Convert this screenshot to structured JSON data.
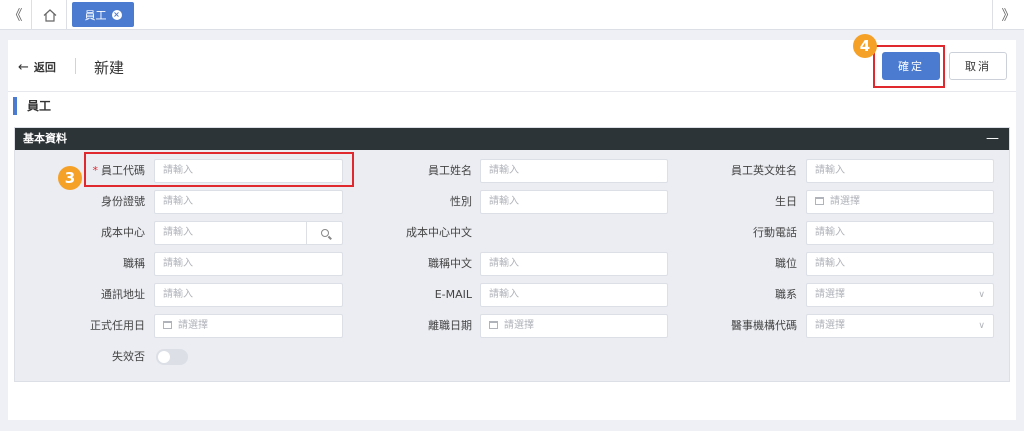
{
  "topbar": {
    "nav_left": "《",
    "nav_right": "》",
    "home_icon": "home-icon",
    "tab_label": "員工",
    "tab_close": "×"
  },
  "header": {
    "back_label": "返回",
    "title": "新建",
    "confirm_label": "確定",
    "cancel_label": "取消"
  },
  "callouts": {
    "step3": "3",
    "step4": "4"
  },
  "section_title": "員工",
  "panel": {
    "title": "基本資料",
    "collapse": "—"
  },
  "fields": {
    "emp_code": {
      "label": "員工代碼",
      "required": "*",
      "placeholder": "請輸入"
    },
    "emp_name": {
      "label": "員工姓名",
      "placeholder": "請輸入"
    },
    "emp_en_name": {
      "label": "員工英文姓名",
      "placeholder": "請輸入"
    },
    "id_no": {
      "label": "身份證號",
      "placeholder": "請輸入"
    },
    "gender": {
      "label": "性別",
      "placeholder": "請輸入"
    },
    "birthday": {
      "label": "生日",
      "placeholder": "請選擇"
    },
    "cost_center": {
      "label": "成本中心",
      "placeholder": "請輸入"
    },
    "cost_center_cn": {
      "label": "成本中心中文"
    },
    "mobile": {
      "label": "行動電話",
      "placeholder": "請輸入"
    },
    "job_title": {
      "label": "職稱",
      "placeholder": "請輸入"
    },
    "job_title_cn": {
      "label": "職稱中文",
      "placeholder": "請輸入"
    },
    "position": {
      "label": "職位",
      "placeholder": "請輸入"
    },
    "address": {
      "label": "通訊地址",
      "placeholder": "請輸入"
    },
    "email": {
      "label": "E-MAIL",
      "placeholder": "請輸入"
    },
    "job_series": {
      "label": "職系",
      "placeholder": "請選擇"
    },
    "hire_date": {
      "label": "正式任用日",
      "placeholder": "請選擇"
    },
    "leave_date": {
      "label": "離職日期",
      "placeholder": "請選擇"
    },
    "hr_org_code": {
      "label": "醫事機構代碼",
      "placeholder": "請選擇"
    },
    "inactive": {
      "label": "失效否"
    }
  },
  "colors": {
    "primary": "#4a7bd0",
    "highlight": "#e0282f",
    "callout": "#f5a128",
    "panel_head": "#2d3437"
  }
}
